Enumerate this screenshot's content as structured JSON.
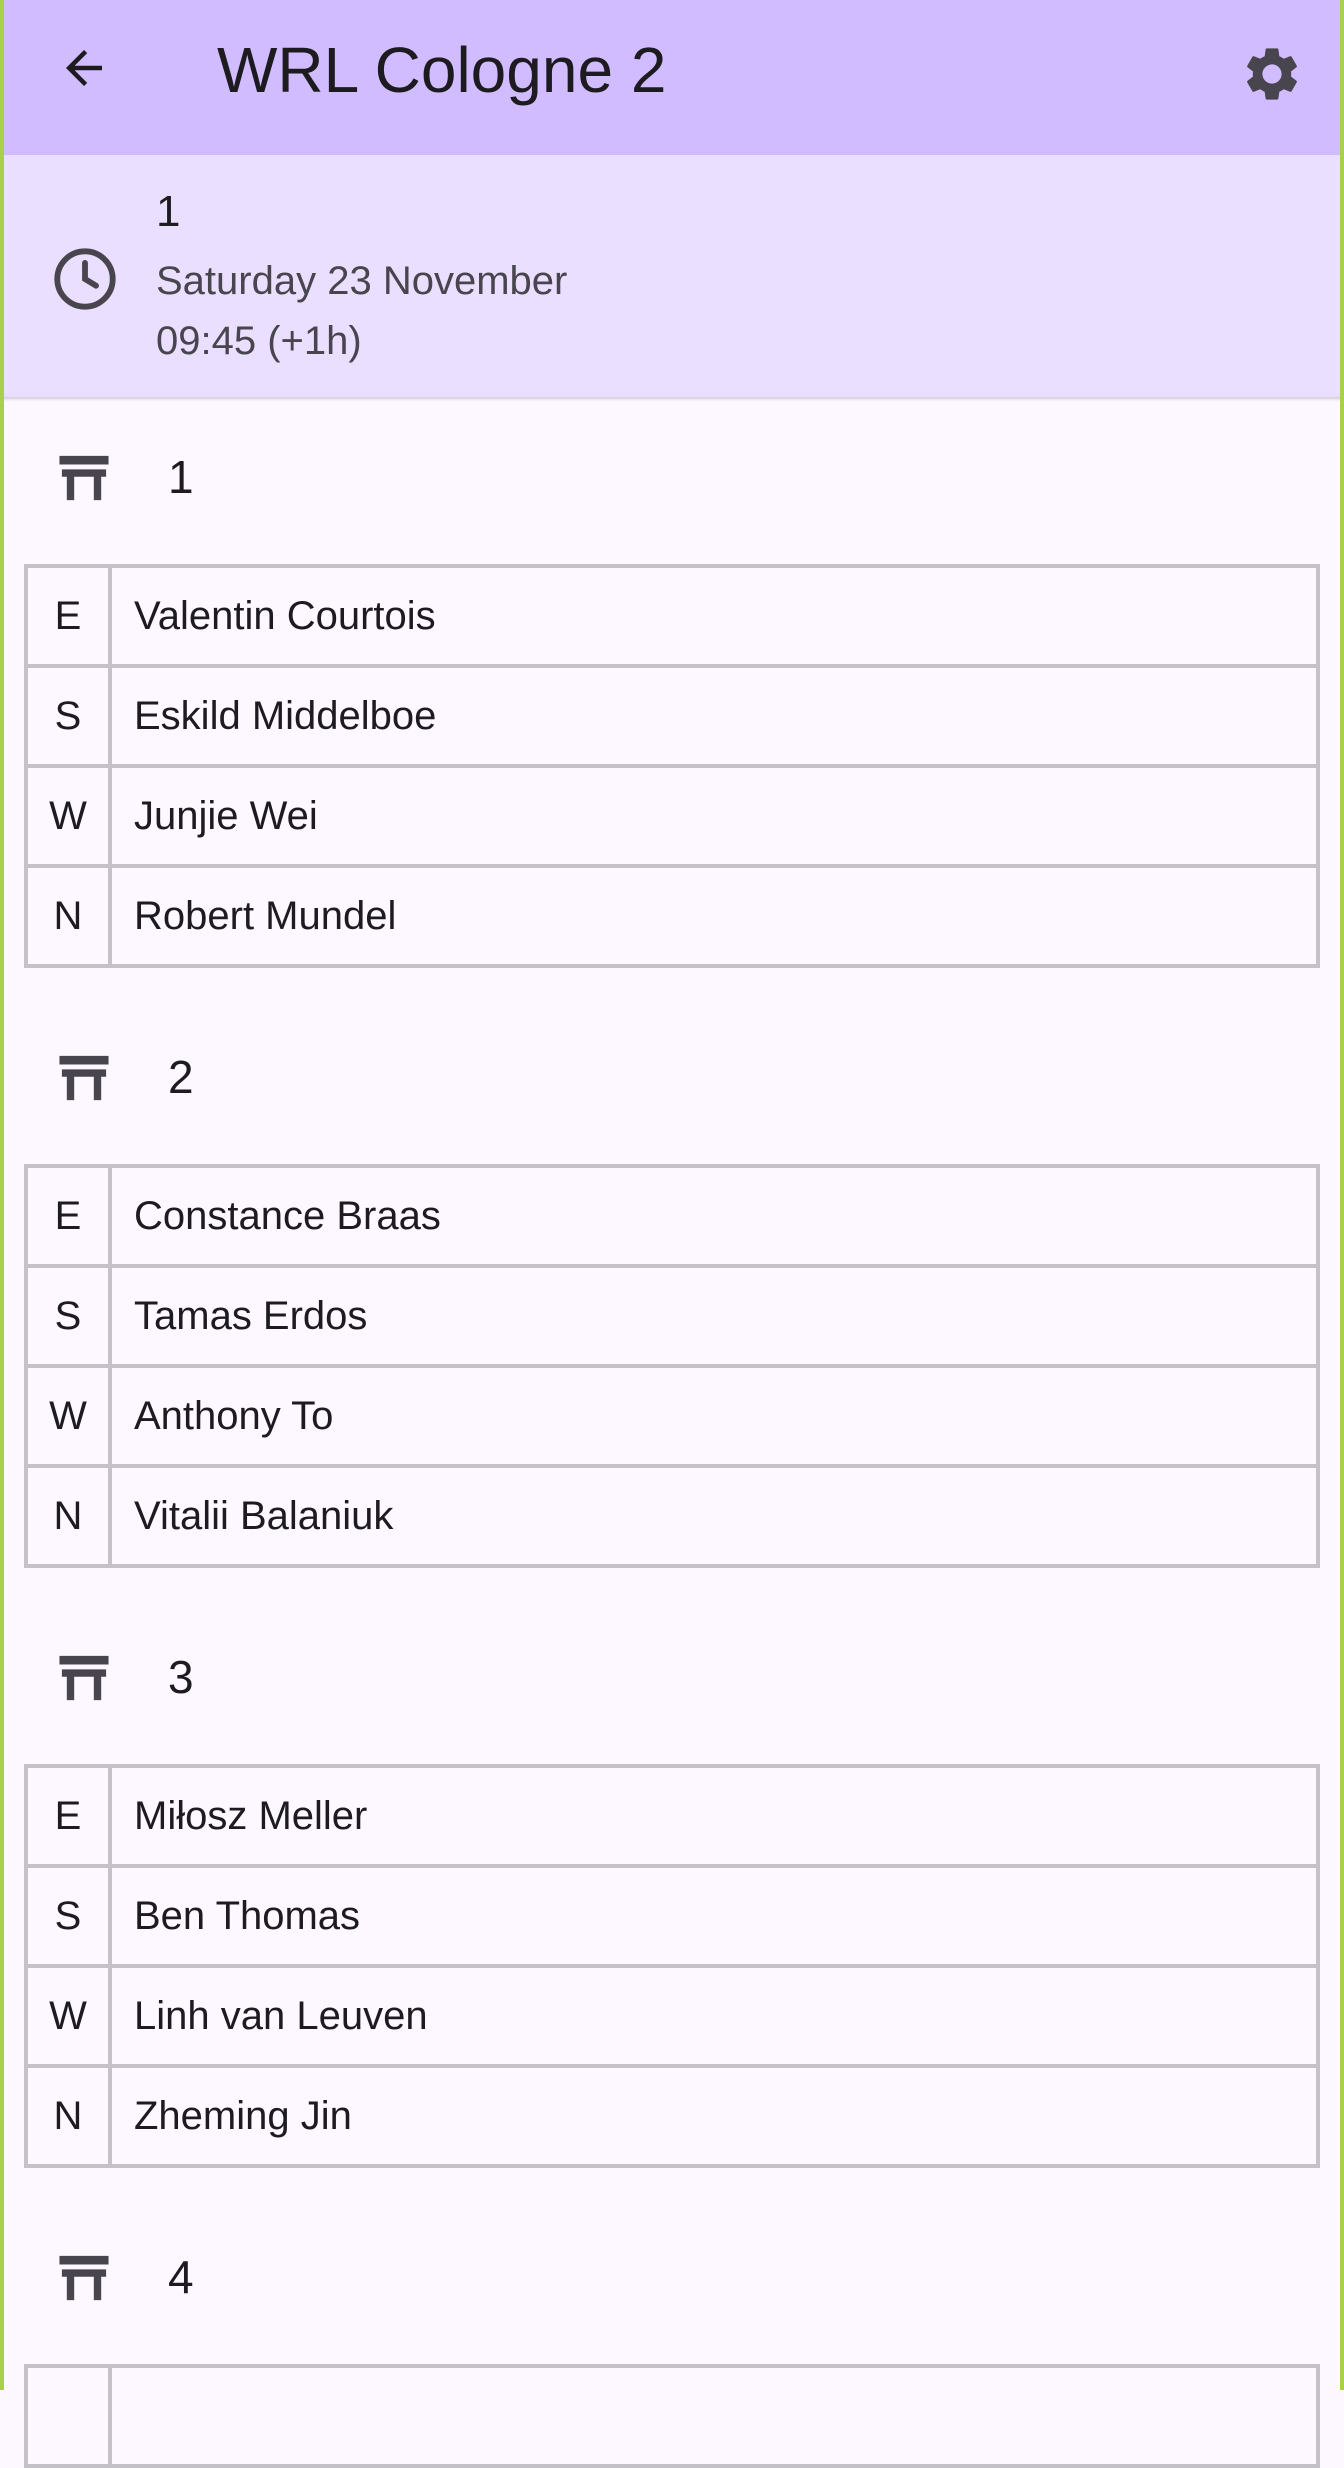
{
  "appbar": {
    "title": "WRL Cologne 2",
    "back_icon": "arrow-back-icon",
    "settings_icon": "gear-icon"
  },
  "round": {
    "number": "1",
    "date": "Saturday 23 November",
    "time": "09:45 (+1h)",
    "icon": "clock-icon"
  },
  "tables": [
    {
      "number": "1",
      "seats": [
        {
          "seat": "E",
          "player": "Valentin Courtois"
        },
        {
          "seat": "S",
          "player": "Eskild Middelboe"
        },
        {
          "seat": "W",
          "player": "Junjie Wei"
        },
        {
          "seat": "N",
          "player": "Robert Mundel"
        }
      ]
    },
    {
      "number": "2",
      "seats": [
        {
          "seat": "E",
          "player": "Constance Braas"
        },
        {
          "seat": "S",
          "player": "Tamas Erdos"
        },
        {
          "seat": "W",
          "player": "Anthony To"
        },
        {
          "seat": "N",
          "player": "Vitalii Balaniuk"
        }
      ]
    },
    {
      "number": "3",
      "seats": [
        {
          "seat": "E",
          "player": "Miłosz Meller"
        },
        {
          "seat": "S",
          "player": "Ben Thomas"
        },
        {
          "seat": "W",
          "player": "Linh van Leuven"
        },
        {
          "seat": "N",
          "player": "Zheming Jin"
        }
      ]
    },
    {
      "number": "4",
      "seats": []
    }
  ],
  "colors": {
    "appbar": "#d0bcff",
    "round_header": "#ebdfff",
    "background": "#fdf7ff",
    "border": "#c4c2c8",
    "frame": "#a8d04a"
  }
}
